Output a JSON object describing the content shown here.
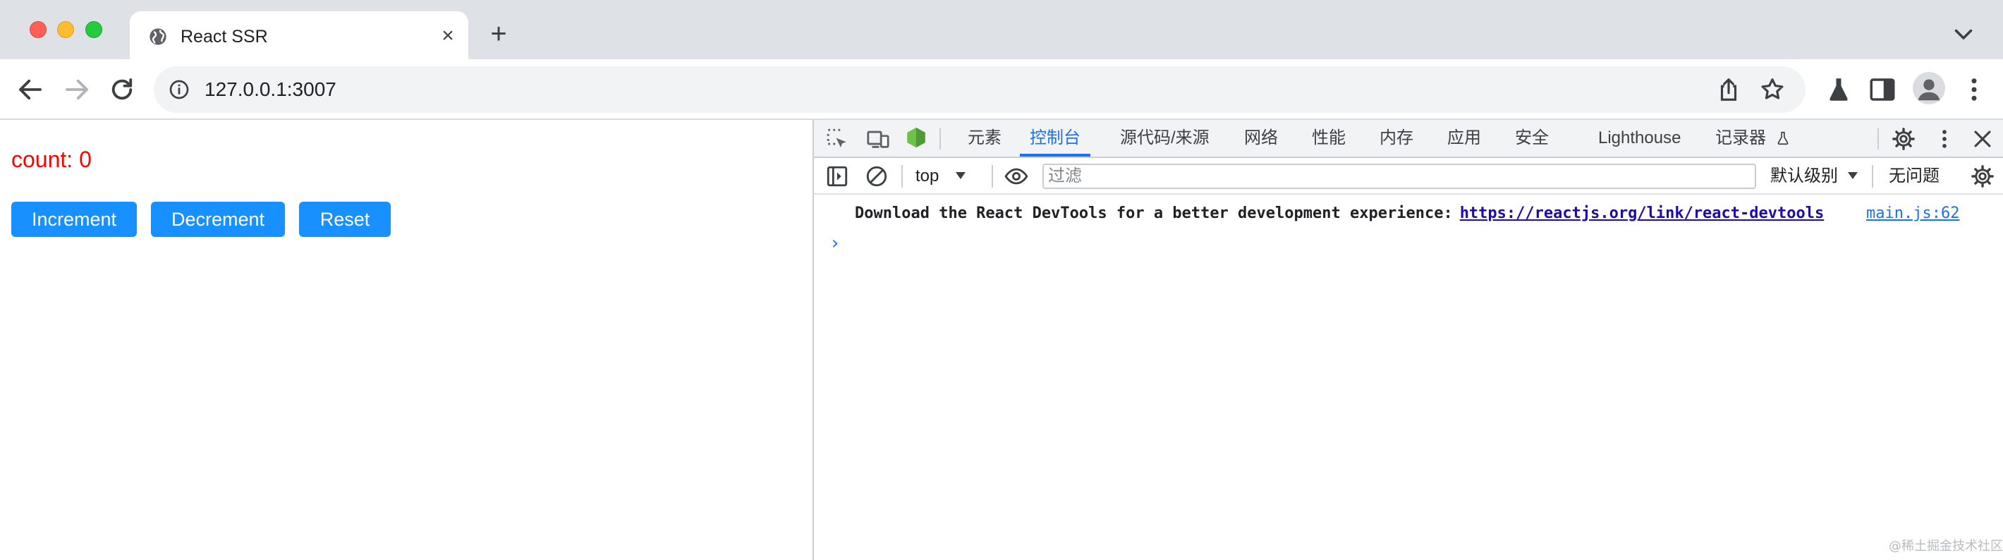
{
  "browser": {
    "tab": {
      "title": "React SSR",
      "close": "×"
    },
    "new_tab": "+",
    "address": {
      "url": "127.0.0.1:3007"
    }
  },
  "page": {
    "count_text": "count: 0",
    "buttons": [
      {
        "label": "Increment",
        "color": "#1890ff"
      },
      {
        "label": "Decrement",
        "color": "#1890ff"
      },
      {
        "label": "Reset",
        "color": "#1890ff"
      }
    ],
    "count_color": "#ff0000"
  },
  "devtools": {
    "tabs": [
      {
        "label": "元素"
      },
      {
        "label": "控制台",
        "active": true
      },
      {
        "label": "源代码/来源"
      },
      {
        "label": "网络"
      },
      {
        "label": "性能"
      },
      {
        "label": "内存"
      },
      {
        "label": "应用"
      },
      {
        "label": "安全"
      },
      {
        "label": "Lighthouse"
      },
      {
        "label": "记录器"
      }
    ],
    "console_toolbar": {
      "context": "top",
      "filter_placeholder": "过滤",
      "levels": "默认级别",
      "issues": "无问题"
    },
    "messages": [
      {
        "text": "Download the React DevTools for a better development experience:",
        "link": "https://reactjs.org/link/react-devtools",
        "source": "main.js:62"
      }
    ],
    "prompt": "›"
  },
  "watermark": "@稀土掘金技术社区"
}
